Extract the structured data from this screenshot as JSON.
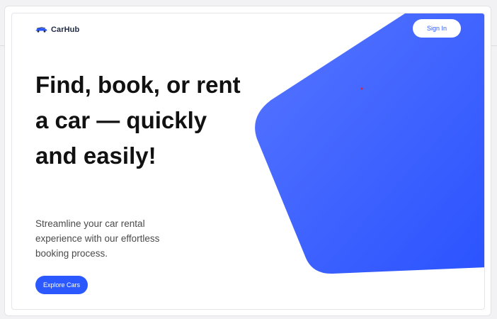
{
  "brand": {
    "name": "CarHub",
    "icon": "car-icon",
    "accent_color": "#2b59ff"
  },
  "header": {
    "signin_label": "Sign In"
  },
  "hero": {
    "title": "Find, book, or rent a car — quickly and easily!",
    "subtitle": "Streamline your car rental experience with our effortless booking process.",
    "cta_label": "Explore Cars"
  }
}
